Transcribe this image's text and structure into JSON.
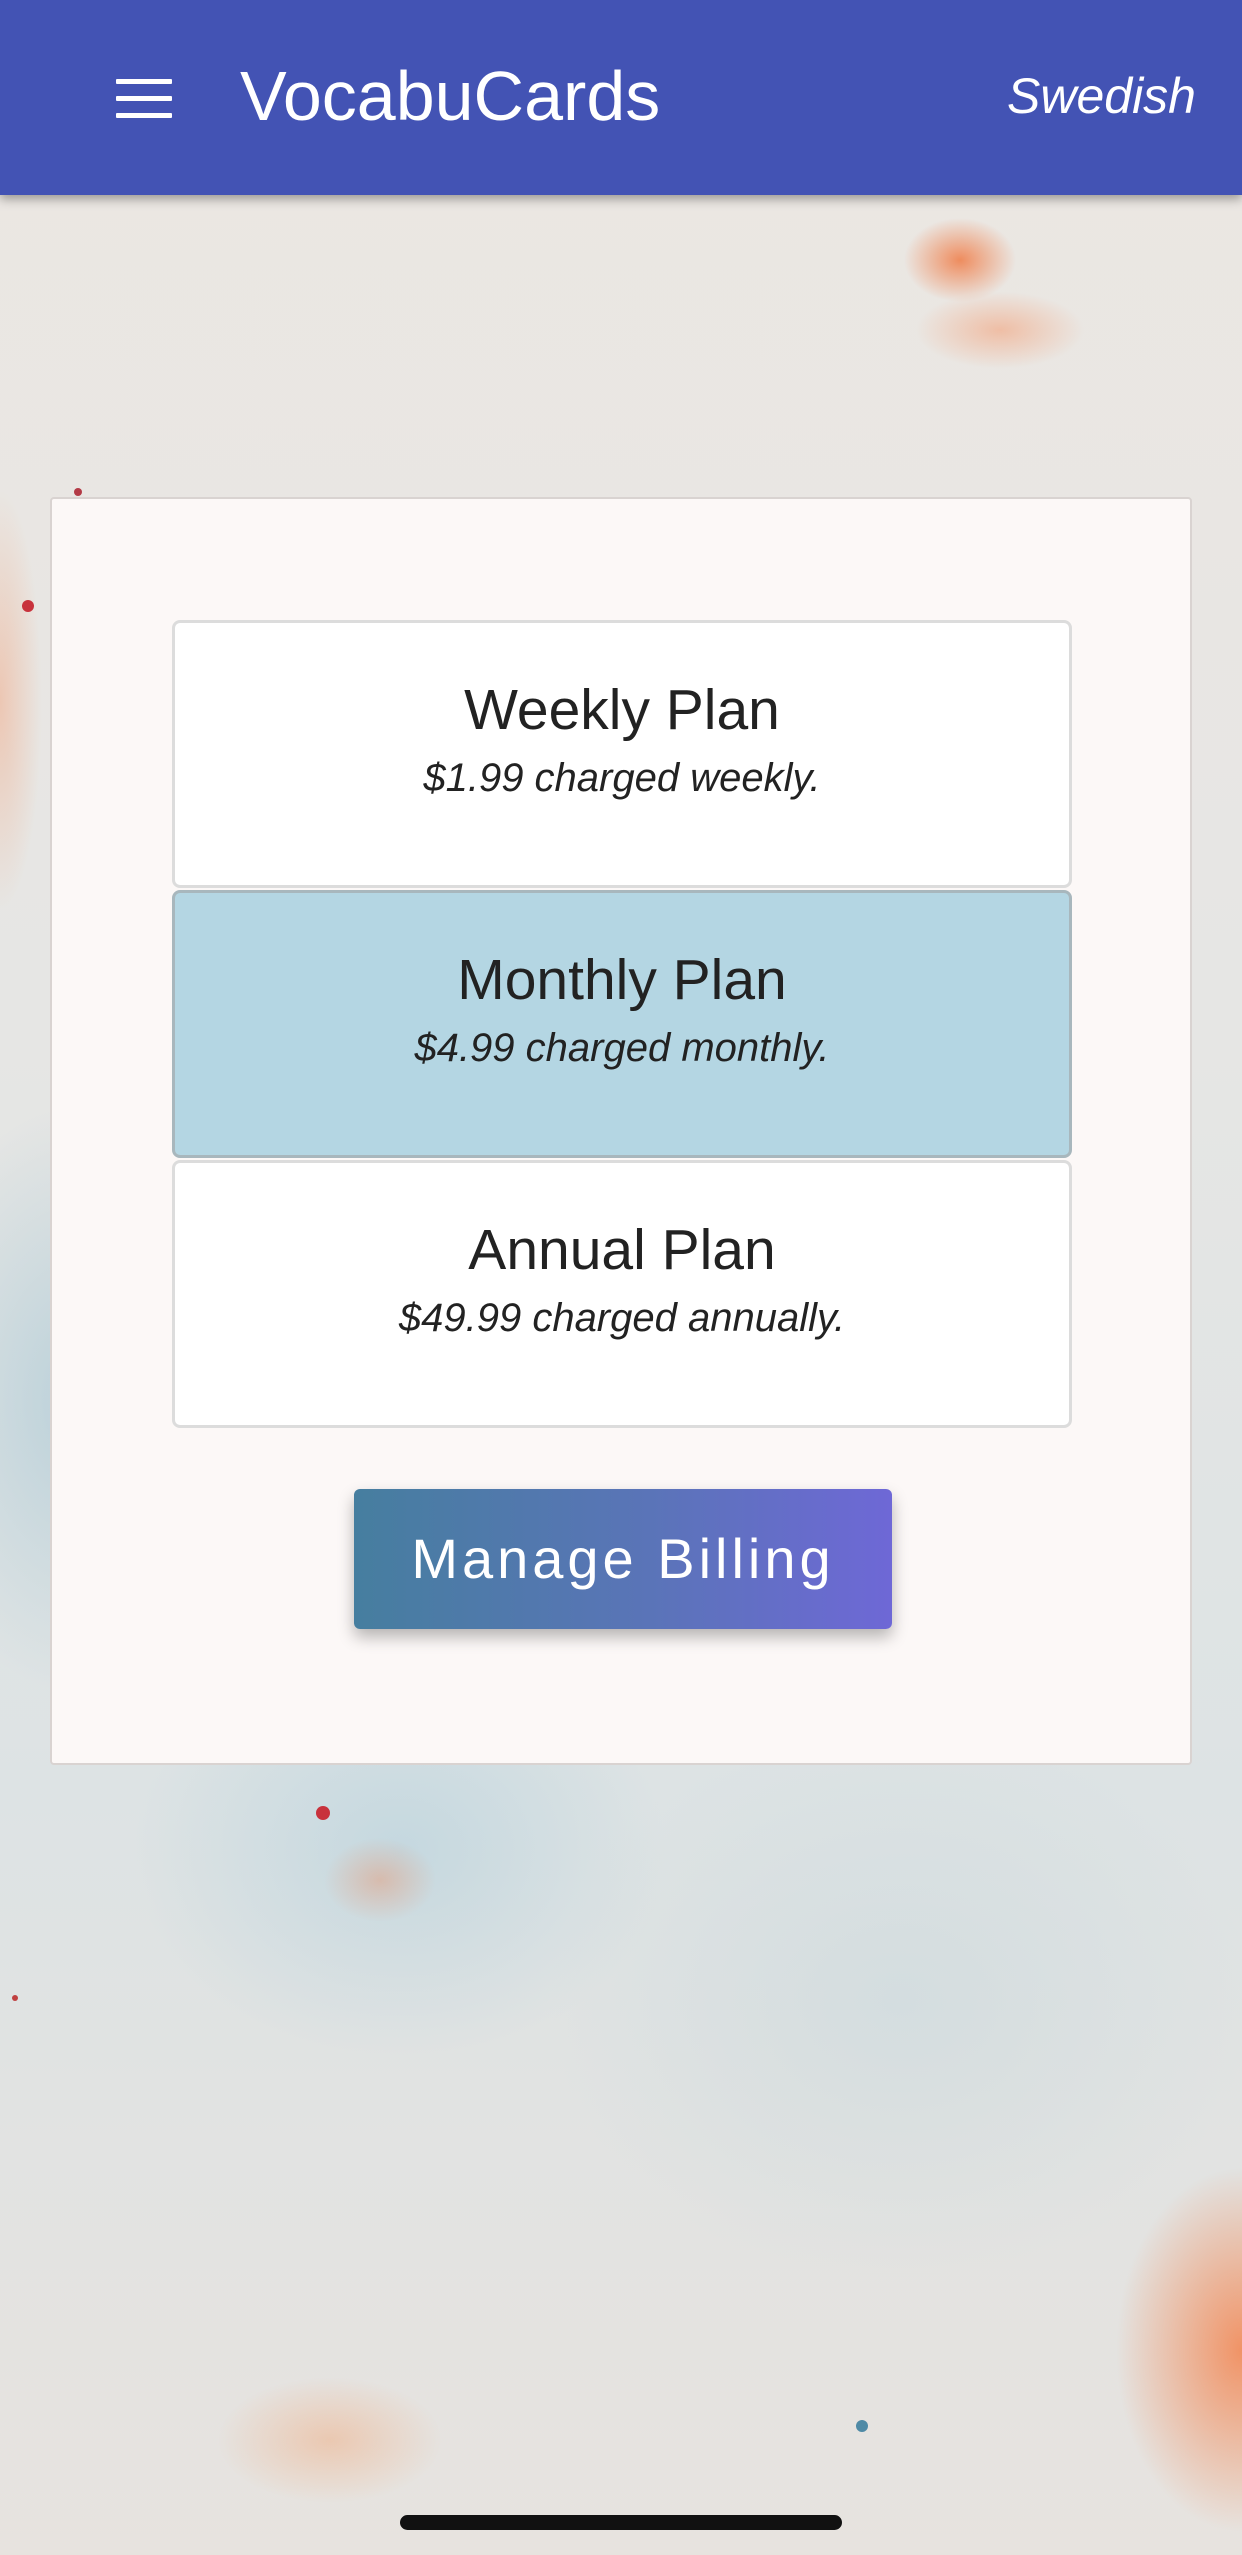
{
  "app_bar": {
    "title": "VocabuCards",
    "language": "Swedish",
    "menu_icon": "hamburger-menu-icon"
  },
  "plans": [
    {
      "name": "Weekly Plan",
      "price": "$1.99 charged weekly.",
      "selected": false
    },
    {
      "name": "Monthly Plan",
      "price": "$4.99 charged monthly.",
      "selected": true
    },
    {
      "name": "Annual Plan",
      "price": "$49.99 charged annually.",
      "selected": false
    }
  ],
  "manage_billing_label": "Manage Billing",
  "colors": {
    "app_bar": "#4353b4",
    "selected_plan": "#b4d6e3",
    "button_gradient_start": "#467e9f",
    "button_gradient_end": "#6e68d6"
  }
}
